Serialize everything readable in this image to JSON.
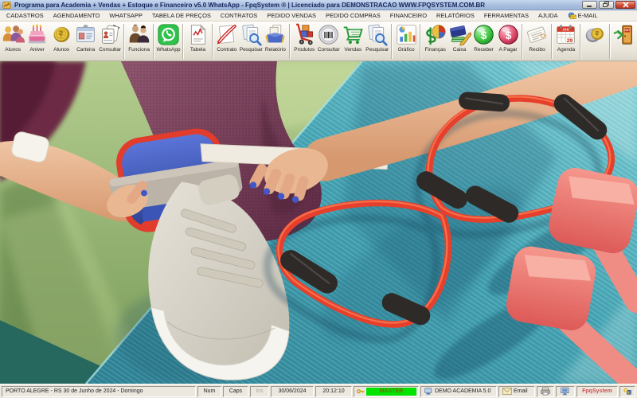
{
  "window": {
    "title": "Programa para Academia + Vendas + Estoque e Financeiro v5.0 WhatsApp - FpqSystem ® | Licenciado para  DEMONSTRACAO WWW.FPQSYSTEM.COM.BR"
  },
  "menu": {
    "items": [
      "CADASTROS",
      "AGENDAMENTO",
      "WHATSAPP",
      "TABELA DE PREÇOS",
      "CONTRATOS",
      "PEDIDO VENDAS",
      "PEDIDO COMPRAS",
      "FINANCEIRO",
      "RELATÓRIOS",
      "FERRAMENTAS",
      "AJUDA",
      "E-MAIL"
    ]
  },
  "toolbar": {
    "buttons": [
      {
        "label": "Alunos",
        "icon": "students"
      },
      {
        "label": "Aniver",
        "icon": "birthday-cake"
      },
      {
        "label": "Alunos",
        "icon": "gold-coin"
      },
      {
        "label": "Carteira",
        "icon": "id-card"
      },
      {
        "label": "Consultar",
        "icon": "person-cards"
      },
      {
        "label": "Funciona",
        "icon": "employees"
      },
      {
        "label": "WhatsApp",
        "icon": "whatsapp"
      },
      {
        "label": "Tabela",
        "icon": "price-table"
      },
      {
        "label": "Contrato",
        "icon": "contract-pen"
      },
      {
        "label": "Pesquisar",
        "icon": "search-docs"
      },
      {
        "label": "Relatório",
        "icon": "report-box"
      },
      {
        "label": "Produtos",
        "icon": "hand-truck"
      },
      {
        "label": "Consultar",
        "icon": "barcode"
      },
      {
        "label": "Vendas",
        "icon": "shopping-cart"
      },
      {
        "label": "Pesquisar",
        "icon": "search-docs"
      },
      {
        "label": "Gráfico",
        "icon": "bar-chart"
      },
      {
        "label": "Finanças",
        "icon": "finance-money"
      },
      {
        "label": "Caixa",
        "icon": "cash-book"
      },
      {
        "label": "Receber",
        "icon": "receive-sphere"
      },
      {
        "label": "A Pagar",
        "icon": "pay-sphere"
      },
      {
        "label": "Recibo",
        "icon": "receipt"
      },
      {
        "label": "Agenda",
        "icon": "calendar"
      },
      {
        "label": "",
        "icon": "coins"
      },
      {
        "label": "",
        "icon": "exit-door"
      }
    ],
    "calendar_month": "JAN",
    "calendar_day": "29",
    "exit_sign": "OUT"
  },
  "glyphs": {
    "dollar": "$"
  },
  "statusbar": {
    "location_date": "PORTO ALEGRE - RS  30 de Junho de 2024 - Domingo",
    "num": "Num",
    "caps": "Caps",
    "ins": "Ins",
    "date": "30/06/2024",
    "time": "20:12:10",
    "access_level": "MASTER",
    "system_name": "DEMO ACADEMIA 5.0",
    "email": "Email",
    "brand": "FpqSystem"
  },
  "colors": {
    "titlebar_blue": "#a6bddd",
    "access_green": "#00e400",
    "brand_red": "#c9504e",
    "whatsapp_green": "#2fc24a",
    "mat_teal": "#3e9fb1",
    "floor_green": "#8faf6d"
  }
}
